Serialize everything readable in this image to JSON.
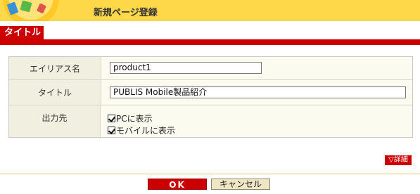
{
  "header": {
    "page_title": "新規ページ登録"
  },
  "tabs": [
    {
      "label": "タイトル",
      "active": true
    }
  ],
  "form": {
    "alias": {
      "label": "エイリアス名",
      "value": "product1"
    },
    "title": {
      "label": "タイトル",
      "value": "PUBLIS Mobile製品紹介"
    },
    "output": {
      "label": "出力先",
      "options": [
        {
          "label": "PCに表示",
          "checked": true
        },
        {
          "label": "モバイルに表示",
          "checked": true
        }
      ]
    }
  },
  "detail_button": {
    "label": "▽詳細"
  },
  "actions": {
    "ok_label": "OK",
    "cancel_label": "キャンセル"
  },
  "colors": {
    "header_bg": "#ffd84a",
    "accent_red": "#cc0000",
    "label_bg": "#f1efdf",
    "panel_bg": "#fbfbef"
  }
}
